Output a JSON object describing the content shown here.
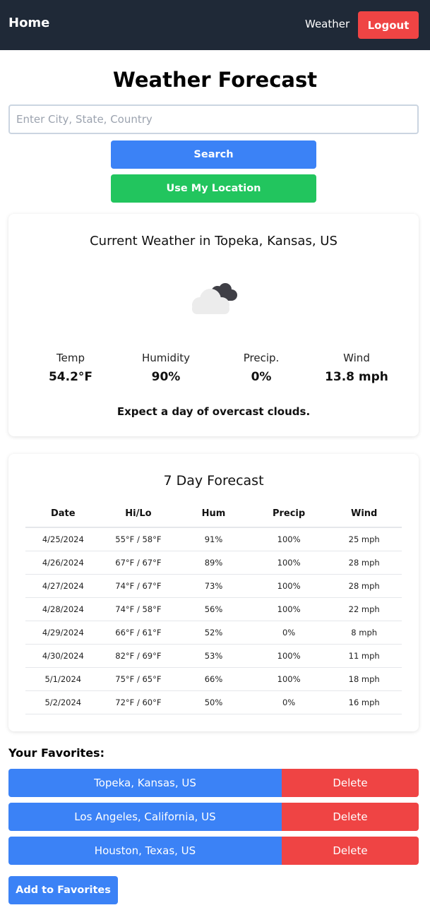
{
  "nav": {
    "home_label": "Home",
    "weather_label": "Weather",
    "logout_label": "Logout"
  },
  "page": {
    "title": "Weather Forecast"
  },
  "search": {
    "value": "",
    "placeholder": "Enter City, State, Country",
    "search_label": "Search",
    "location_label": "Use My Location"
  },
  "current": {
    "title": "Current Weather in Topeka, Kansas, US",
    "icon": "overcast-clouds-icon",
    "temp_label": "Temp",
    "temp_value": "54.2°F",
    "humidity_label": "Humidity",
    "humidity_value": "90%",
    "precip_label": "Precip.",
    "precip_value": "0%",
    "wind_label": "Wind",
    "wind_value": "13.8 mph",
    "description": "Expect a day of overcast clouds."
  },
  "forecast": {
    "title": "7 Day Forecast",
    "headers": [
      "Date",
      "Hi/Lo",
      "Hum",
      "Precip",
      "Wind"
    ],
    "rows": [
      [
        "4/25/2024",
        "55°F / 58°F",
        "91%",
        "100%",
        "25 mph"
      ],
      [
        "4/26/2024",
        "67°F / 67°F",
        "89%",
        "100%",
        "28 mph"
      ],
      [
        "4/27/2024",
        "74°F / 67°F",
        "73%",
        "100%",
        "28 mph"
      ],
      [
        "4/28/2024",
        "74°F / 58°F",
        "56%",
        "100%",
        "22 mph"
      ],
      [
        "4/29/2024",
        "66°F / 61°F",
        "52%",
        "0%",
        "8 mph"
      ],
      [
        "4/30/2024",
        "82°F / 69°F",
        "53%",
        "100%",
        "11 mph"
      ],
      [
        "5/1/2024",
        "75°F / 65°F",
        "66%",
        "100%",
        "18 mph"
      ],
      [
        "5/2/2024",
        "72°F / 60°F",
        "50%",
        "0%",
        "16 mph"
      ]
    ]
  },
  "favorites": {
    "heading": "Your Favorites:",
    "delete_label": "Delete",
    "items": [
      {
        "name": "Topeka, Kansas, US"
      },
      {
        "name": "Los Angeles, California, US"
      },
      {
        "name": "Houston, Texas, US"
      }
    ],
    "add_label": "Add to Favorites"
  },
  "colors": {
    "navbar": "#1f2937",
    "primary": "#3b82f6",
    "success": "#22c55e",
    "danger": "#ef4444"
  }
}
